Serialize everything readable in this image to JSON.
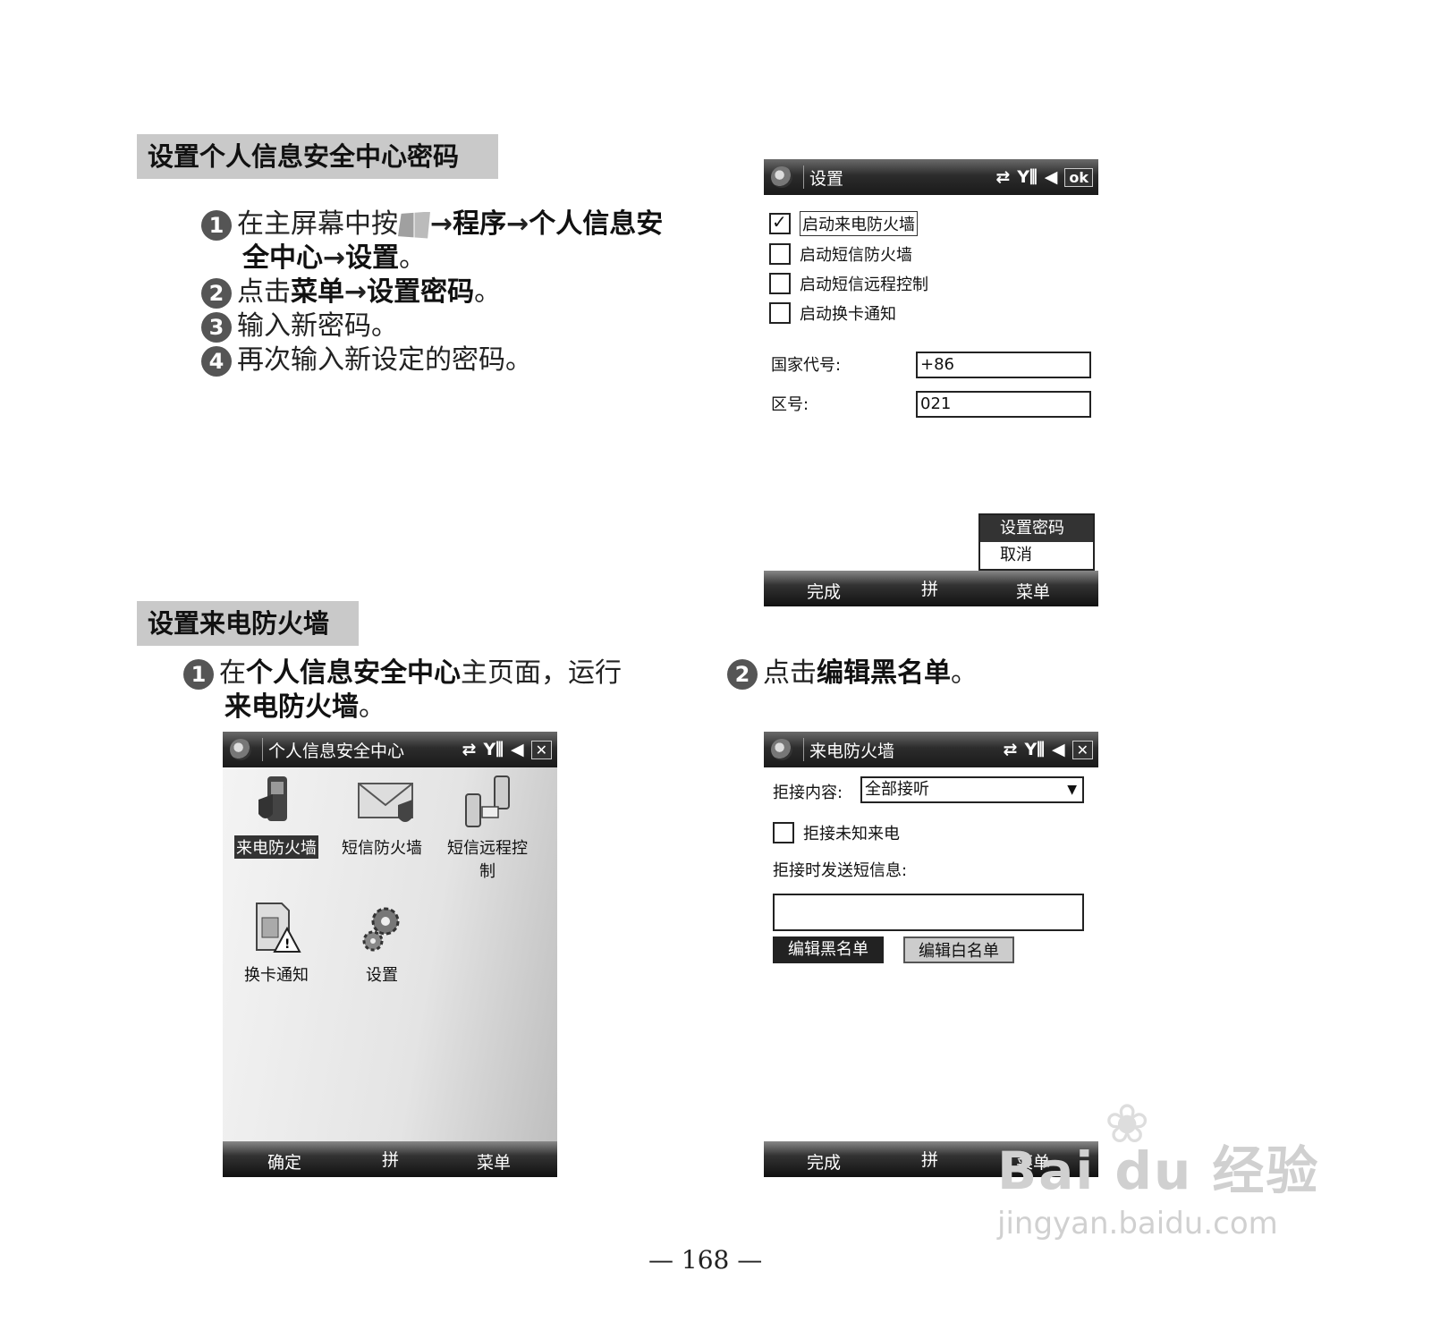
{
  "section1": {
    "title": "设置个人信息安全中心密码",
    "steps": [
      {
        "num": "1",
        "a": "在主屏幕中按",
        "arrow1": "→",
        "b1": "程序",
        "arrow2": "→",
        "b2": "个人信息安",
        "b3": "全中心",
        "arrow3": "→",
        "b4": "设置",
        "end": "。"
      },
      {
        "num": "2",
        "a": "点击",
        "b1": "菜单",
        "arrow1": "→",
        "b2": "设置密码",
        "end": "。"
      },
      {
        "num": "3",
        "text": "输入新密码。"
      },
      {
        "num": "4",
        "text": "再次输入新设定的密码。"
      }
    ]
  },
  "screen_settings": {
    "title": "设置",
    "ok": "ok",
    "checkboxes": [
      {
        "label": "启动来电防火墙",
        "checked": true
      },
      {
        "label": "启动短信防火墙",
        "checked": false
      },
      {
        "label": "启动短信远程控制",
        "checked": false
      },
      {
        "label": "启动换卡通知",
        "checked": false
      }
    ],
    "country_label": "国家代号:",
    "country_value": "+86",
    "area_label": "区号:",
    "area_value": "021",
    "menu": [
      "设置密码",
      "取消"
    ],
    "soft_left": "完成",
    "soft_mid": "拼",
    "soft_right": "菜单"
  },
  "section2": {
    "title": "设置来电防火墙",
    "step1": {
      "num": "1",
      "a": "在",
      "b1": "个人信息安全中心",
      "c": "主页面，运行",
      "b2": "来电防火墙",
      "end": "。"
    },
    "step2": {
      "num": "2",
      "a": "点击",
      "b": "编辑黑名单",
      "end": "。"
    }
  },
  "screen_center": {
    "title": "个人信息安全中心",
    "apps": [
      {
        "label": "来电防火墙",
        "icon": "phone-shield-icon"
      },
      {
        "label": "短信防火墙",
        "icon": "envelope-shield-icon"
      },
      {
        "label": "短信远程控",
        "label2": "制",
        "icon": "phones-envelope-icon"
      },
      {
        "label": "换卡通知",
        "icon": "simcard-warning-icon"
      },
      {
        "label": "设置",
        "icon": "gears-icon"
      }
    ],
    "soft_left": "确定",
    "soft_mid": "拼",
    "soft_right": "菜单"
  },
  "screen_firewall": {
    "title": "来电防火墙",
    "reject_label": "拒接内容:",
    "reject_value": "全部接听",
    "unknown_label": "拒接未知来电",
    "sms_label": "拒接时发送短信息:",
    "sms_value": "",
    "black_btn": "编辑黑名单",
    "white_btn": "编辑白名单",
    "soft_left": "完成",
    "soft_mid": "拼",
    "soft_right": "菜单"
  },
  "page_number": "— 168 —",
  "watermark": {
    "brand": "Bai du 经验",
    "url": "jingyan.baidu.com"
  }
}
